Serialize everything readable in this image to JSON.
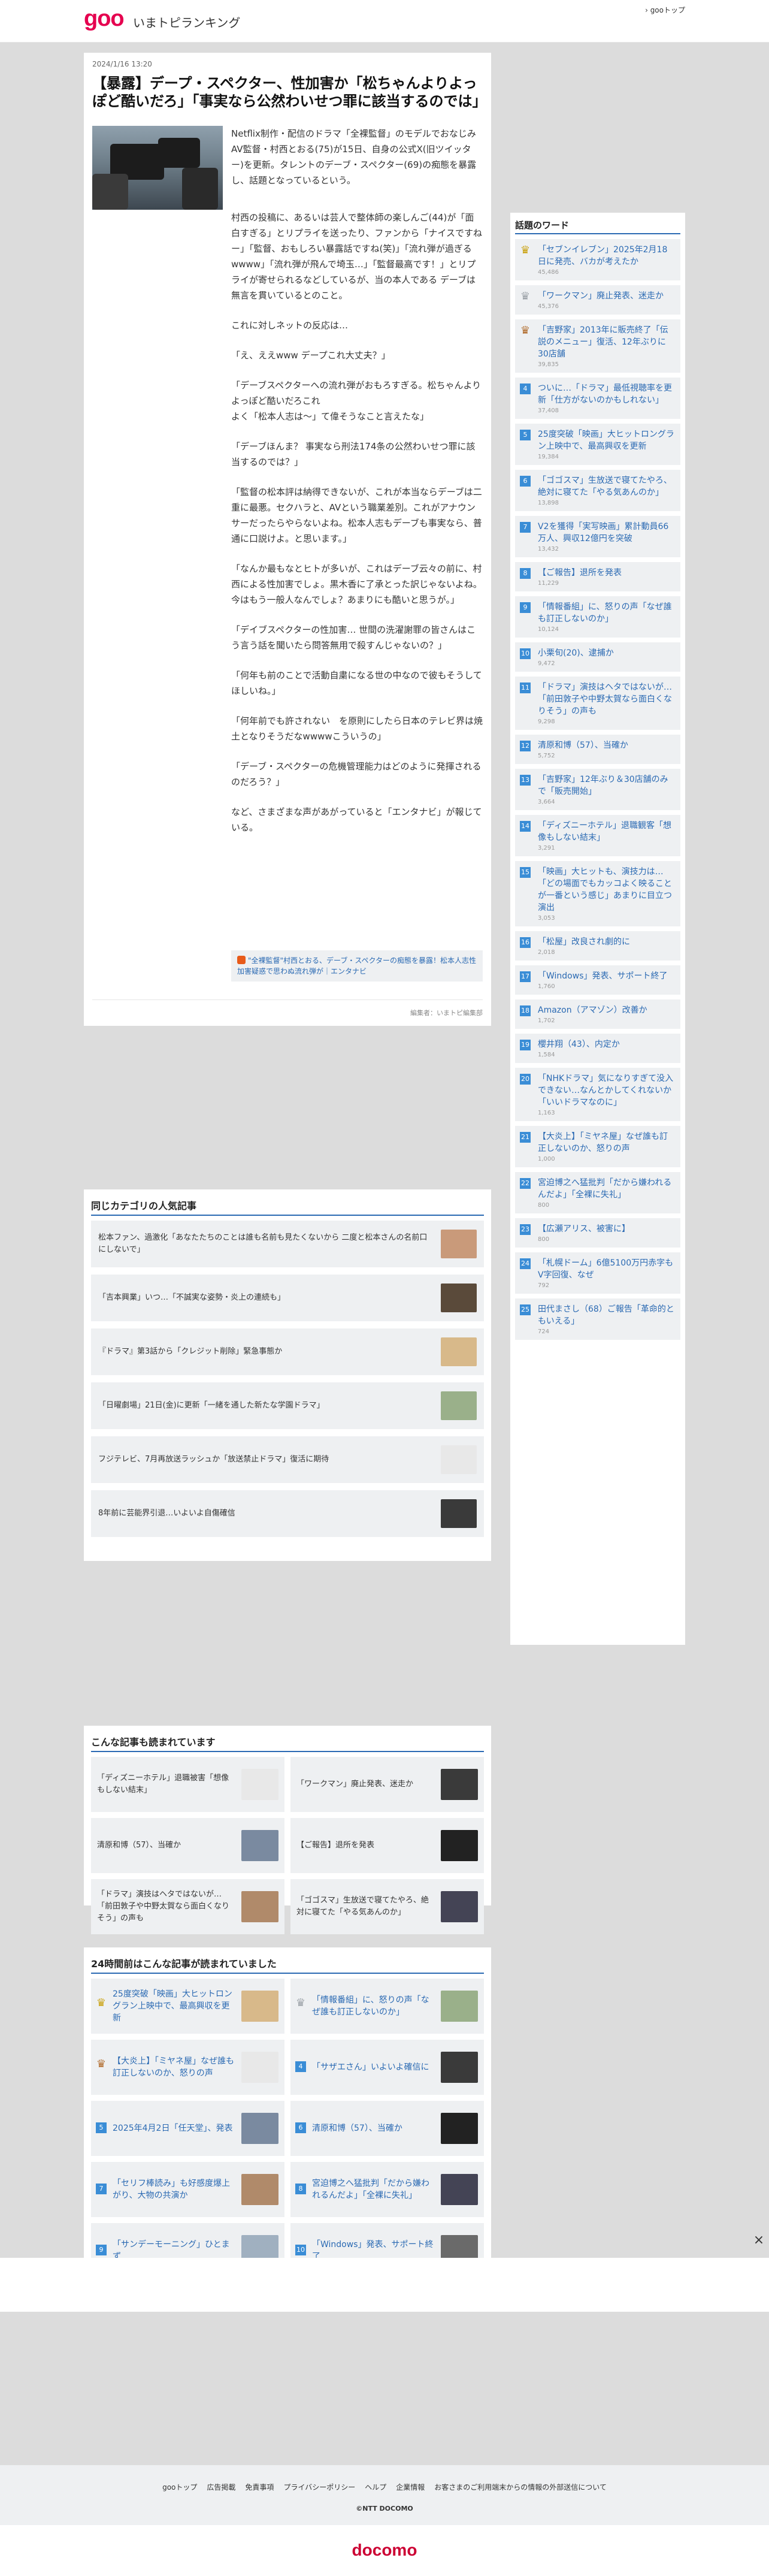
{
  "header": {
    "logo": "goo",
    "site_name": "いまトピランキング",
    "top_link": "› gooトップ"
  },
  "article": {
    "date": "2024/1/16 13:20",
    "title": "【暴露】デープ・スペクター、性加害か「松ちゃんよりよっぽど酷いだろ」「事実なら公然わいせつ罪に該当するのでは」",
    "lead": "Netflix制作・配信のドラマ「全裸監督」のモデルでおなじみAV監督・村西とおる(75)が15日、自身の公式X(旧ツイッター)を更新。タレントのデーブ・スペクター(69)の痴態を暴露し、話題となっているという。",
    "paragraphs": [
      "村西の投稿に、あるいは芸人で整体師の楽しんご(44)が「面白すぎる」とリプライを送ったり、ファンから「ナイスですねー」「監督、おもしろい暴露話ですね(笑)」「流れ弾が過ぎるwwww」「流れ弾が飛んで埼玉…」「監督最高です！」とリプライが寄せられるなどしているが、当の本人である デーブは無言を貫いているとのこと。",
      "これに対しネットの反応は…",
      "「え、ええwww デープこれ大丈夫？」",
      "「デーブスペクターへの流れ弾がおもろすぎる。松ちゃんよりよっぽど酷いだろこれ\nよく「松本人志は〜」て偉そうなこと言えたな」",
      "「デーブほんま？ 事実なら刑法174条の公然わいせつ罪に該当するのでは？」",
      "「監督の松本評は納得できないが、これが本当ならデーブは二重に最悪。セクハラと、AVという職業差別。これがアナウンサーだったらやらないよね。松本人志もデーブも事実なら、普通に口説けよ。と思います。」",
      "「なんか最もなとヒトが多いが、これはデーブ云々の前に、村西による性加害でしょ。黒木香に了承とった訳じゃないよね。今はもう一般人なんでしょ？あまりにも酷いと思うが。」",
      "「デイブスペクターの性加害… 世間の洗濯謝罪の皆さんはこう言う話を聞いたら問答無用で殺すんじゃないの？」",
      "「何年も前のことで活動自粛になる世の中なので彼もそうしてほしいね。」",
      "「何年前でも許されない　を原則にしたら日本のテレビ界は焼土となりそうだなwwwwこういうの」",
      "「デーブ・スペクターの危機管理能力はどのように発揮されるのだろう？」",
      "など、さまざまな声があがっていると「エンタナビ」が報じている。"
    ],
    "related_link": "\"全裸監督\"村西とおる、デーブ・スペクターの痴態を暴露！松本人志性加害疑惑で思わぬ流れ弾が｜エンタナビ",
    "credit": "編集者：いまトピ編集部"
  },
  "sidebar": {
    "title": "話題のワード",
    "items": [
      {
        "rank": "crown",
        "text": "「セブンイレブン」2025年2月18日に発売、バカが考えたか",
        "count": "45,486"
      },
      {
        "rank": "crown-silver",
        "text": "「ワークマン」廃止発表、迷走か",
        "count": "45,376"
      },
      {
        "rank": "crown-bronze",
        "text": "「吉野家」2013年に販売終了「伝説のメニュー」復活、12年ぶりに30店舗",
        "count": "39,835"
      },
      {
        "rank": "4",
        "text": "ついに…「ドラマ」最低視聴率を更新「仕方がないのかもしれない」",
        "count": "37,408"
      },
      {
        "rank": "5",
        "text": "25度突破「映画」大ヒットロングラン上映中で、最高興収を更新",
        "count": "19,384"
      },
      {
        "rank": "6",
        "text": "「ゴゴスマ」生放送で寝てたやろ、絶対に寝てた「やる気あんのか」",
        "count": "13,898"
      },
      {
        "rank": "7",
        "text": "V2を獲得「実写映画」累計動員66万人、興収12億円を突破",
        "count": "13,432"
      },
      {
        "rank": "8",
        "text": "【ご報告】退所を発表",
        "count": "11,229"
      },
      {
        "rank": "9",
        "text": "「情報番組」に、怒りの声「なぜ誰も訂正しないのか」",
        "count": "10,124"
      },
      {
        "rank": "10",
        "text": "小栗旬(20)、逮捕か",
        "count": "9,472"
      },
      {
        "rank": "11",
        "text": "「ドラマ」演技はヘタではないが…「前田敦子や中野太賀なら面白くなりそう」の声も",
        "count": "9,298"
      },
      {
        "rank": "12",
        "text": "清原和博（57）、当確か",
        "count": "5,752"
      },
      {
        "rank": "13",
        "text": "「吉野家」12年ぶり＆30店舗のみで「販売開始」",
        "count": "3,664"
      },
      {
        "rank": "14",
        "text": "「ディズニーホテル」退職観客「想像もしない結末」",
        "count": "3,291"
      },
      {
        "rank": "15",
        "text": "「映画」大ヒットも、演技力は…「どの場面でもカッコよく映ることが一番という感じ」あまりに目立つ演出",
        "count": "3,053"
      },
      {
        "rank": "16",
        "text": "「松屋」改良され劇的に",
        "count": "2,018"
      },
      {
        "rank": "17",
        "text": "「Windows」発表、サポート終了",
        "count": "1,760"
      },
      {
        "rank": "18",
        "text": "Amazon（アマゾン）改善か",
        "count": "1,702"
      },
      {
        "rank": "19",
        "text": "櫻井翔（43）、内定か",
        "count": "1,584"
      },
      {
        "rank": "20",
        "text": "「NHKドラマ」気になりすぎて没入できない…なんとかしてくれないか「いいドラマなのに」",
        "count": "1,163"
      },
      {
        "rank": "21",
        "text": "【大炎上】「ミヤネ屋」なぜ誰も訂正しないのか、怒りの声",
        "count": "1,000"
      },
      {
        "rank": "22",
        "text": "宮迫博之へ猛批判「だから嫌われるんだよ」「全裸に失礼」",
        "count": "800"
      },
      {
        "rank": "23",
        "text": "【広瀬アリス、被害に】",
        "count": "800"
      },
      {
        "rank": "24",
        "text": "「札幌ドーム」6億5100万円赤字もV字回復、なぜ",
        "count": "792"
      },
      {
        "rank": "25",
        "text": "田代まさし（68）ご報告「革命的ともいえる」",
        "count": "724"
      }
    ]
  },
  "category": {
    "title": "同じカテゴリの人気記事",
    "items": [
      {
        "text": "松本ファン、過激化「あなたたちのことは誰も名前も見たくないから 二度と松本さんの名前口にしないで」"
      },
      {
        "text": "「吉本興業」いつ…「不誠実な姿勢・炎上の連続も」"
      },
      {
        "text": "『ドラマ』第3話から「クレジット削除」緊急事態か"
      },
      {
        "text": "「日曜劇場」21日(金)に更新「一緒を通した新たな学園ドラマ」"
      },
      {
        "text": "フジテレビ、7月再放送ラッシュか「放送禁止ドラマ」復活に期待"
      },
      {
        "text": "8年前に芸能界引退…いよいよ自傷確信"
      }
    ]
  },
  "also_read": {
    "title": "こんな記事も読まれています",
    "items": [
      {
        "text": "「ディズニーホテル」退職被害「想像もしない結末」"
      },
      {
        "text": "「ワークマン」廃止発表、迷走か"
      },
      {
        "text": "清原和博（57）、当確か"
      },
      {
        "text": "【ご報告】退所を発表"
      },
      {
        "text": "「ドラマ」演技はヘタではないが…「前田敦子や中野太賀なら面白くなりそう」の声も"
      },
      {
        "text": "「ゴゴスマ」生放送で寝てたやろ、絶対に寝てた「やる気あんのか」"
      }
    ]
  },
  "ranking24": {
    "title": "24時間前はこんな記事が読まれていました",
    "items": [
      {
        "rank": "crown",
        "text": "25度突破「映画」大ヒットロングラン上映中で、最高興収を更新"
      },
      {
        "rank": "crown-silver",
        "text": "「情報番組」に、怒りの声「なぜ誰も訂正しないのか」"
      },
      {
        "rank": "crown-bronze",
        "text": "【大炎上】「ミヤネ屋」なぜ誰も訂正しないのか、怒りの声"
      },
      {
        "rank": "4",
        "text": "「サザエさん」いよいよ確信に"
      },
      {
        "rank": "5",
        "text": "2025年4月2日「任天堂」、発表"
      },
      {
        "rank": "6",
        "text": "清原和博（57）、当確か"
      },
      {
        "rank": "7",
        "text": "「セリフ棒読み」も好感度爆上がり、大物の共演か"
      },
      {
        "rank": "8",
        "text": "宮迫博之へ猛批判「だから嫌われるんだよ」「全裸に失礼」"
      },
      {
        "rank": "9",
        "text": "「サンデーモーニング」ひとまず…"
      },
      {
        "rank": "10",
        "text": "「Windows」発表、サポート終了"
      }
    ]
  },
  "footer": {
    "links": [
      "gooトップ",
      "広告掲載",
      "免責事項",
      "プライバシーポリシー",
      "ヘルプ",
      "企業情報",
      "お客さまのご利用端末からの情報の外部送信について"
    ],
    "copyright": "©NTT DOCOMO",
    "brand": "docomo"
  },
  "overlay": {
    "close": "×"
  },
  "colors": {
    "accent": "#2b6ab3",
    "brand": "#e5004f",
    "rank": "#3a8dd6"
  }
}
